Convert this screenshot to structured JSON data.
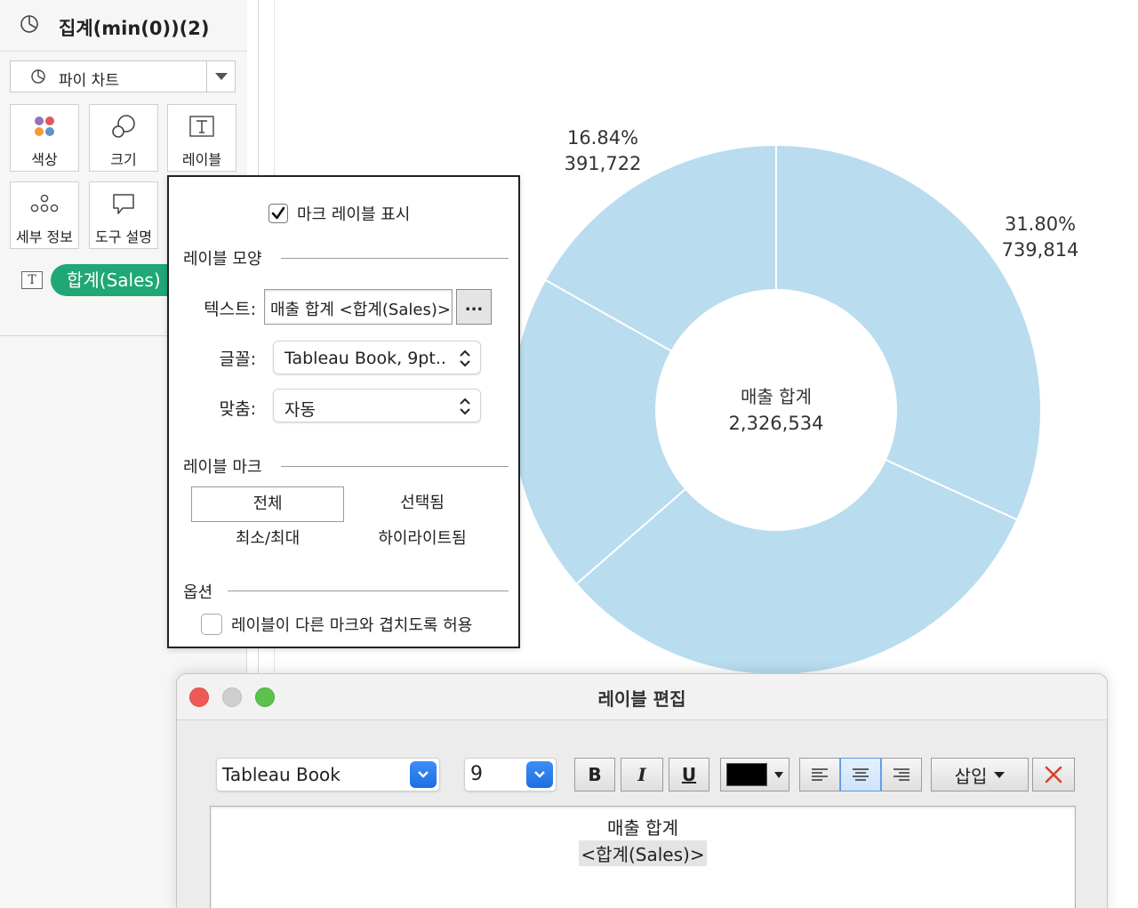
{
  "marks_card": {
    "title": "집계(min(0))(2)",
    "mark_type": "파이 차트",
    "buttons": {
      "color": "색상",
      "size": "크기",
      "label": "레이블",
      "detail": "세부 정보",
      "tooltip": "도구 설명"
    },
    "pill": "합계(Sales)"
  },
  "chart_data": {
    "type": "pie",
    "subtype": "donut",
    "center_title": "매출 합계",
    "center_value": "2,326,534",
    "slice_color": "#b9dcef",
    "slices": [
      {
        "value": 739814,
        "percent": 31.8,
        "percent_label": "31.80%",
        "value_label": "739,814",
        "labeled": true
      },
      {
        "value": 739814,
        "percent": 31.8,
        "labeled": false
      },
      {
        "value": 455184,
        "percent": 19.56,
        "labeled": false
      },
      {
        "value": 391722,
        "percent": 16.84,
        "percent_label": "16.84%",
        "value_label": "391,722",
        "labeled": true
      }
    ]
  },
  "label_popup": {
    "show_labels": "마크 레이블 표시",
    "show_labels_checked": true,
    "appearance_title": "레이블 모양",
    "text_label": "텍스트:",
    "text_value": "매출  합계  <합계(Sales)>",
    "text_more": "...",
    "font_label": "글꼴:",
    "font_value": "Tableau Book, 9pt..",
    "align_label": "맞춤:",
    "align_value": "자동",
    "label_marks_title": "레이블 마크",
    "marks_options": {
      "all": "전체",
      "selected": "선택됨",
      "minmax": "최소/최대",
      "highlighted": "하이라이트됨"
    },
    "options_title": "옵션",
    "overlap_label": "레이블이 다른 마크와 겹치도록 허용",
    "overlap_checked": false
  },
  "edit_dialog": {
    "title": "레이블 편집",
    "font": "Tableau Book",
    "size": "9",
    "bold": "B",
    "italic": "I",
    "underline": "U",
    "text_color": "#000000",
    "insert": "삽입",
    "line1": "매출  합계",
    "line2": "<합계(Sales)>"
  }
}
